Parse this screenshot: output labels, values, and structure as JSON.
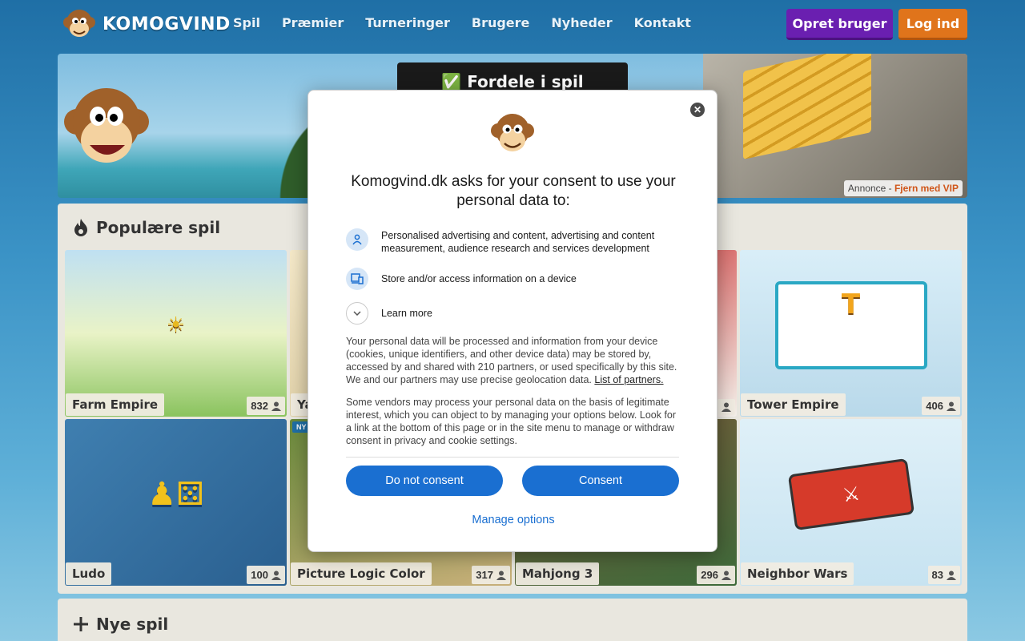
{
  "site": {
    "logo_text": "KOMOGVIND",
    "nav": [
      "Spil",
      "Præmier",
      "Turneringer",
      "Brugere",
      "Nyheder",
      "Kontakt"
    ],
    "signup_label": "Opret bruger",
    "login_label": "Log ind"
  },
  "banner": {
    "cta": "✅ Fordele i spil",
    "ad_prefix": "Annonce - ",
    "ad_link": "Fjern med VIP"
  },
  "popular": {
    "title": "Populære spil",
    "games": [
      {
        "name": "Farm Empire",
        "players": "832"
      },
      {
        "name": "Ya",
        "players": ""
      },
      {
        "name": "",
        "players": ""
      },
      {
        "name": "Tower Empire",
        "players": "406"
      },
      {
        "name": "Ludo",
        "players": "100"
      },
      {
        "name": "Picture Logic Color",
        "players": "317",
        "badge": "NY"
      },
      {
        "name": "Mahjong 3",
        "players": "296"
      },
      {
        "name": "Neighbor Wars",
        "players": "83"
      }
    ]
  },
  "new_games": {
    "title": "Nye spil"
  },
  "consent": {
    "title": "Komogvind.dk asks for your consent to use your personal data to:",
    "purposes": [
      {
        "icon": "person-icon",
        "text": "Personalised advertising and content, advertising and content measurement, audience research and services development"
      },
      {
        "icon": "devices-icon",
        "text": "Store and/or access information on a device"
      }
    ],
    "learn_more": "Learn more",
    "body1": "Your personal data will be processed and information from your device (cookies, unique identifiers, and other device data) may be stored by, accessed by and shared with 210 partners, or used specifically by this site. We and our partners may use precise geolocation data.",
    "partners_link": "List of partners.",
    "body2": "Some vendors may process your personal data on the basis of legitimate interest, which you can object to by managing your options below. Look for a link at the bottom of this page or in the site menu to manage or withdraw consent in privacy and cookie settings.",
    "do_not_consent": "Do not consent",
    "consent": "Consent",
    "manage": "Manage options"
  },
  "colors": {
    "signup": "#6a1fb0",
    "login": "#e0741b",
    "consent_blue": "#1a6fd1"
  }
}
